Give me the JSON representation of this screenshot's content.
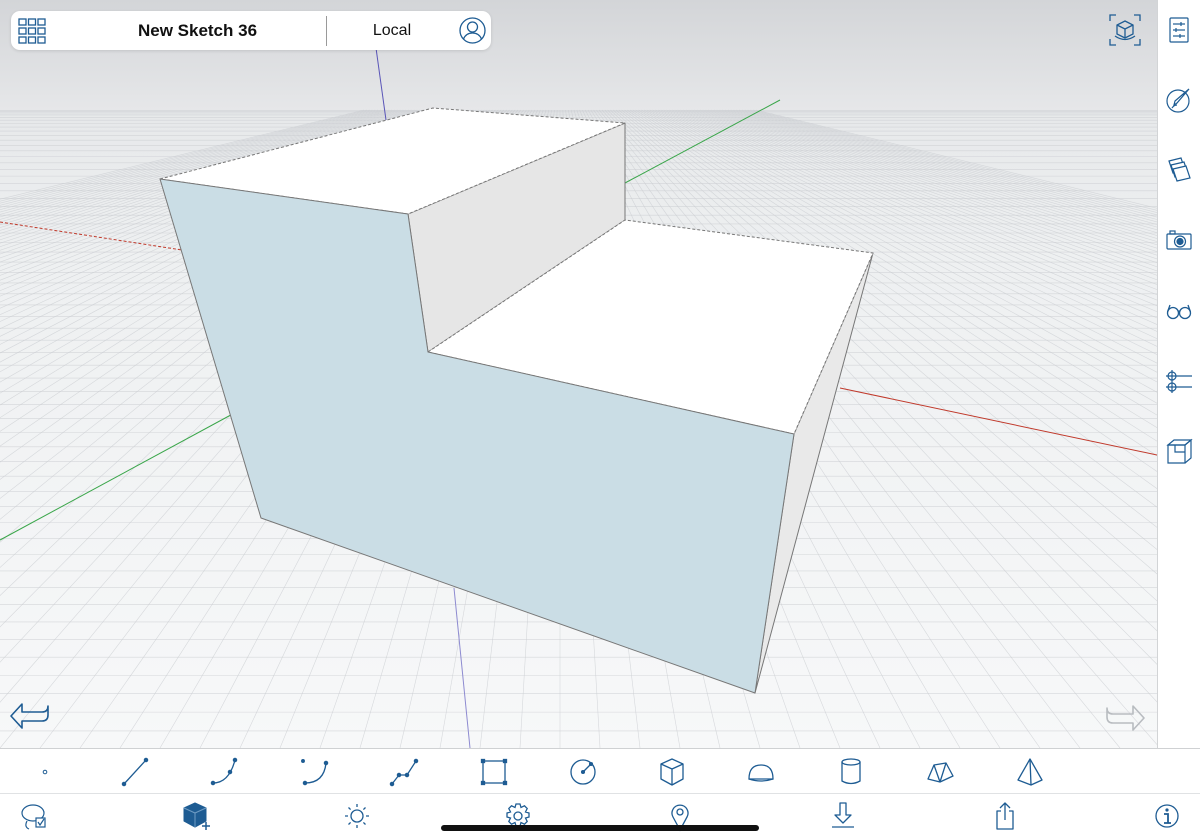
{
  "header": {
    "title": "New Sketch 36",
    "location": "Local"
  },
  "icons": {
    "menu": "grid-menu-icon",
    "account": "user-account-icon",
    "view": "view-cube-icon",
    "undo": "undo-arrow-icon",
    "redo": "redo-arrow-icon"
  },
  "sidebar": [
    "properties-sliders-icon",
    "materials-brush-icon",
    "layers-icon",
    "camera-icon",
    "glasses-icon",
    "section-plane-icon",
    "scene-box-icon"
  ],
  "draw_tools": [
    "point-icon",
    "line-icon",
    "arc-icon",
    "curve-icon",
    "polyline-icon",
    "rectangle-icon",
    "circle-icon",
    "box-icon",
    "hemisphere-icon",
    "cylinder-icon",
    "prism-icon",
    "pyramid-icon"
  ],
  "bottom_tools": [
    "lasso-select-icon",
    "add-object-icon",
    "light-sun-icon",
    "settings-gear-icon",
    "location-pin-icon",
    "import-download-icon",
    "share-export-icon",
    "info-icon"
  ],
  "colors": {
    "accent": "#1e5c93",
    "front_face": "#cadde5",
    "top_face": "#ffffff",
    "side_face": "#e6e6e6",
    "axis_red": "#c0392b",
    "axis_green": "#3aa64a",
    "axis_blue": "#5a55b8"
  }
}
